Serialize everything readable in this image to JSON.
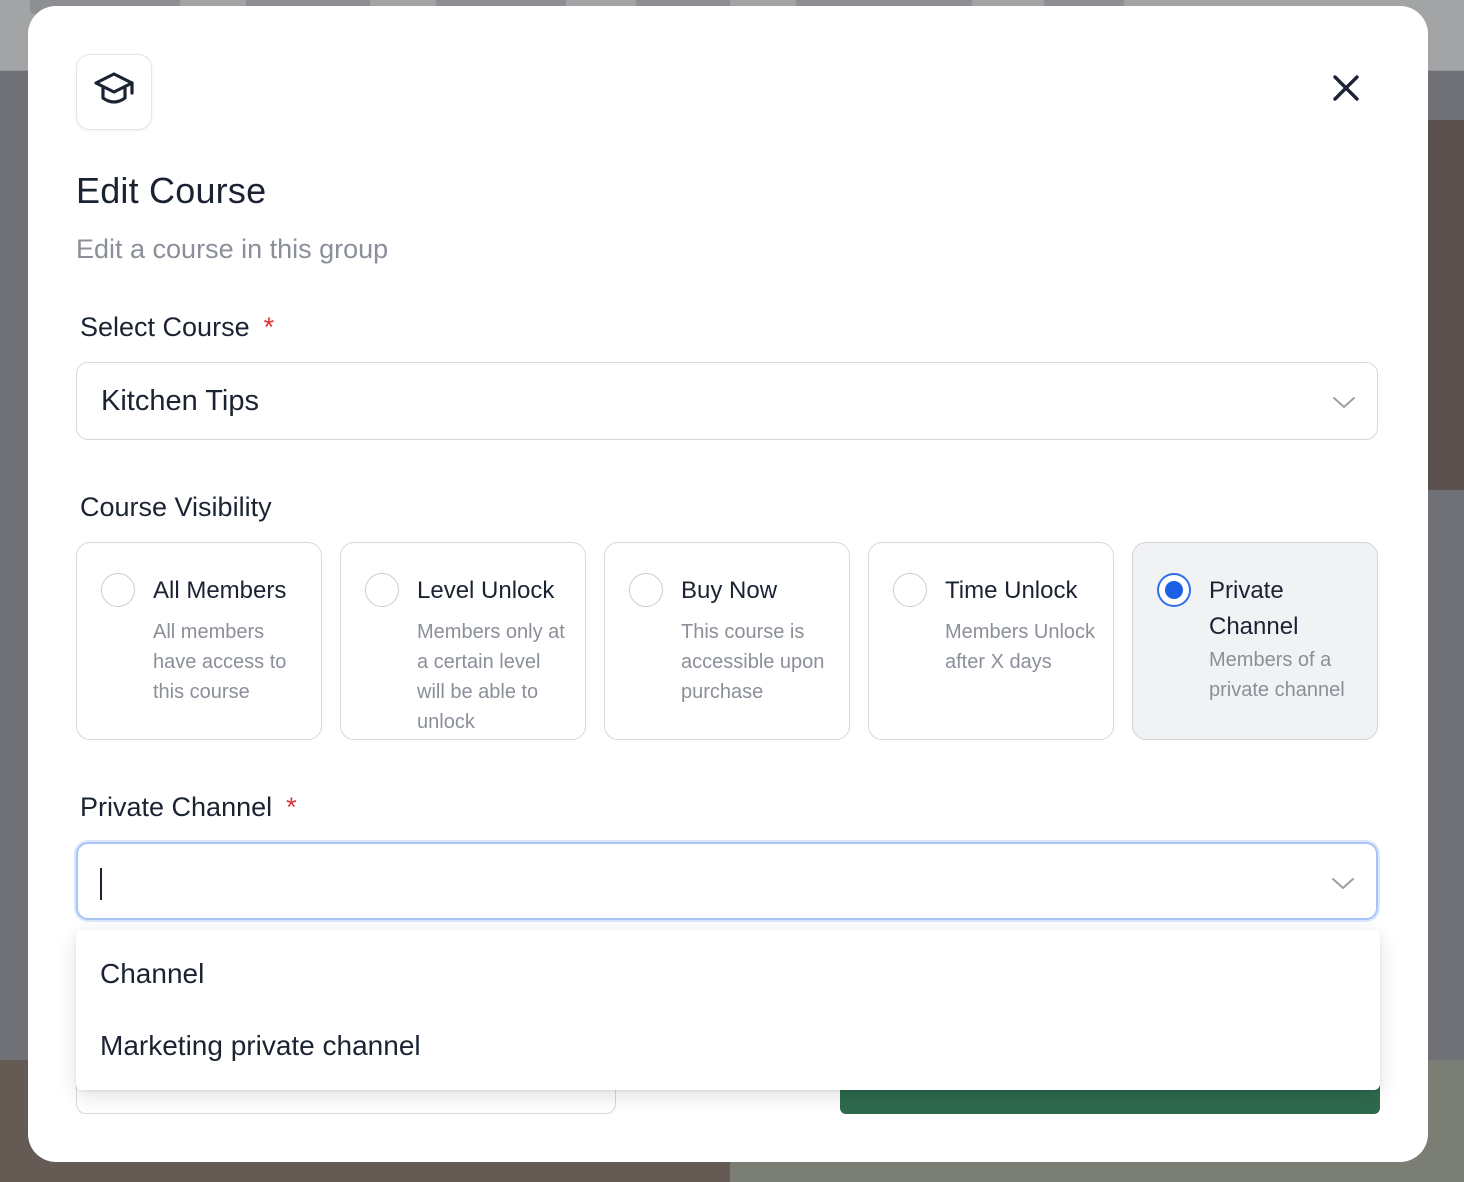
{
  "modal": {
    "title": "Edit Course",
    "subtitle": "Edit a course in this group",
    "icon": "graduation-cap-icon",
    "close_icon": "close-icon"
  },
  "select_course": {
    "label": "Select Course",
    "required_mark": "*",
    "value": "Kitchen Tips"
  },
  "visibility": {
    "label": "Course Visibility",
    "options": [
      {
        "title": "All Members",
        "desc": "All members have access to this course",
        "selected": false
      },
      {
        "title": "Level Unlock",
        "desc": "Members only at a certain level will be able to unlock",
        "selected": false
      },
      {
        "title": "Buy Now",
        "desc": "This course is accessible upon purchase",
        "selected": false
      },
      {
        "title": "Time Unlock",
        "desc": "Members Unlock after X days",
        "selected": false
      },
      {
        "title": "Private Channel",
        "desc": "Members of a private channel",
        "selected": true
      }
    ]
  },
  "private_channel": {
    "label": "Private Channel",
    "required_mark": "*",
    "value": "",
    "options": [
      "Channel",
      "Marketing private channel"
    ]
  },
  "colors": {
    "accent": "#1a5fe6",
    "required": "#e03131",
    "primary_button": "#2e6a4e"
  }
}
